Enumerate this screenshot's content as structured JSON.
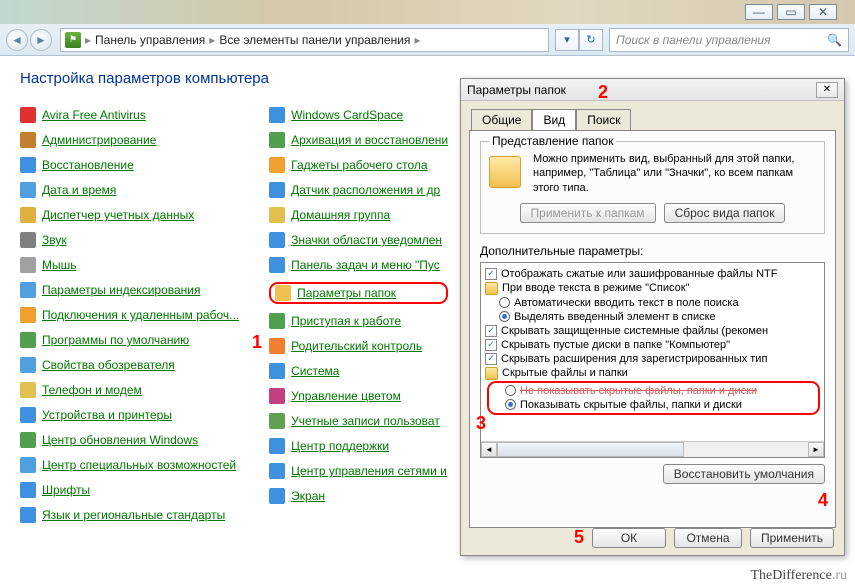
{
  "breadcrumb": {
    "seg1": "Панель управления",
    "seg2": "Все элементы панели управления"
  },
  "search": {
    "placeholder": "Поиск в панели управления"
  },
  "page_title": "Настройка параметров компьютера",
  "col1": [
    "Avira Free Antivirus",
    "Администрирование",
    "Восстановление",
    "Дата и время",
    "Диспетчер учетных данных",
    "Звук",
    "Мышь",
    "Параметры индексирования",
    "Подключения к удаленным рабоч...",
    "Программы по умолчанию",
    "Свойства обозревателя",
    "Телефон и модем",
    "Устройства и принтеры",
    "Центр обновления Windows",
    "Центр специальных возможностей",
    "Шрифты",
    "Язык и региональные стандарты"
  ],
  "col2": [
    "Windows CardSpace",
    "Архивация и восстановлени",
    "Гаджеты рабочего стола",
    "Датчик расположения и др",
    "Домашняя группа",
    "Значки области уведомлен",
    "Панель задач и меню \"Пус",
    "Параметры папок",
    "Приступая к работе",
    "Родительский контроль",
    "Система",
    "Управление цветом",
    "Учетные записи пользоват",
    "Центр поддержки",
    "Центр управления сетями и",
    "Экран"
  ],
  "col1_colors": [
    "#e03030",
    "#c08030",
    "#4090e0",
    "#50a0e0",
    "#e0b040",
    "#808080",
    "#a0a0a0",
    "#50a0e0",
    "#f0a030",
    "#50a050",
    "#50a0e0",
    "#e0c050",
    "#4090e0",
    "#50a050",
    "#50a0e0",
    "#4090e0",
    "#4090e0"
  ],
  "col2_colors": [
    "#4090e0",
    "#50a050",
    "#f0a030",
    "#4090e0",
    "#e0c050",
    "#4090e0",
    "#4090e0",
    "#f0c050",
    "#50a050",
    "#f08030",
    "#4090e0",
    "#c04080",
    "#60a050",
    "#4090e0",
    "#4090e0",
    "#4090e0"
  ],
  "dialog": {
    "title": "Параметры папок",
    "tabs": [
      "Общие",
      "Вид",
      "Поиск"
    ],
    "group_title": "Представление папок",
    "group_text": "Можно применить вид, выбранный для этой папки, например, \"Таблица\" или \"Значки\", ко всем папкам этого типа.",
    "apply_folders": "Применить к папкам",
    "reset_folders": "Сброс вида папок",
    "params_label": "Дополнительные параметры:",
    "tree": {
      "r1": "Отображать сжатые или зашифрованные файлы NTF",
      "r2": "При вводе текста в режиме \"Список\"",
      "r2a": "Автоматически вводить текст в поле поиска",
      "r2b": "Выделять введенный элемент в списке",
      "r3": "Скрывать защищенные системные файлы (рекомен",
      "r4": "Скрывать пустые диски в папке \"Компьютер\"",
      "r5": "Скрывать расширения для зарегистрированных тип",
      "r6": "Скрытые файлы и папки",
      "r6a": "Не показывать скрытые файлы, папки и диски",
      "r6b": "Показывать скрытые файлы, папки и диски"
    },
    "restore": "Восстановить умолчания",
    "ok": "ОК",
    "cancel": "Отмена",
    "apply": "Применить"
  },
  "markers": {
    "m1": "1",
    "m2": "2",
    "m3": "3",
    "m4": "4",
    "m5": "5"
  },
  "watermark": {
    "a": "TheDifference",
    "b": ".ru"
  }
}
